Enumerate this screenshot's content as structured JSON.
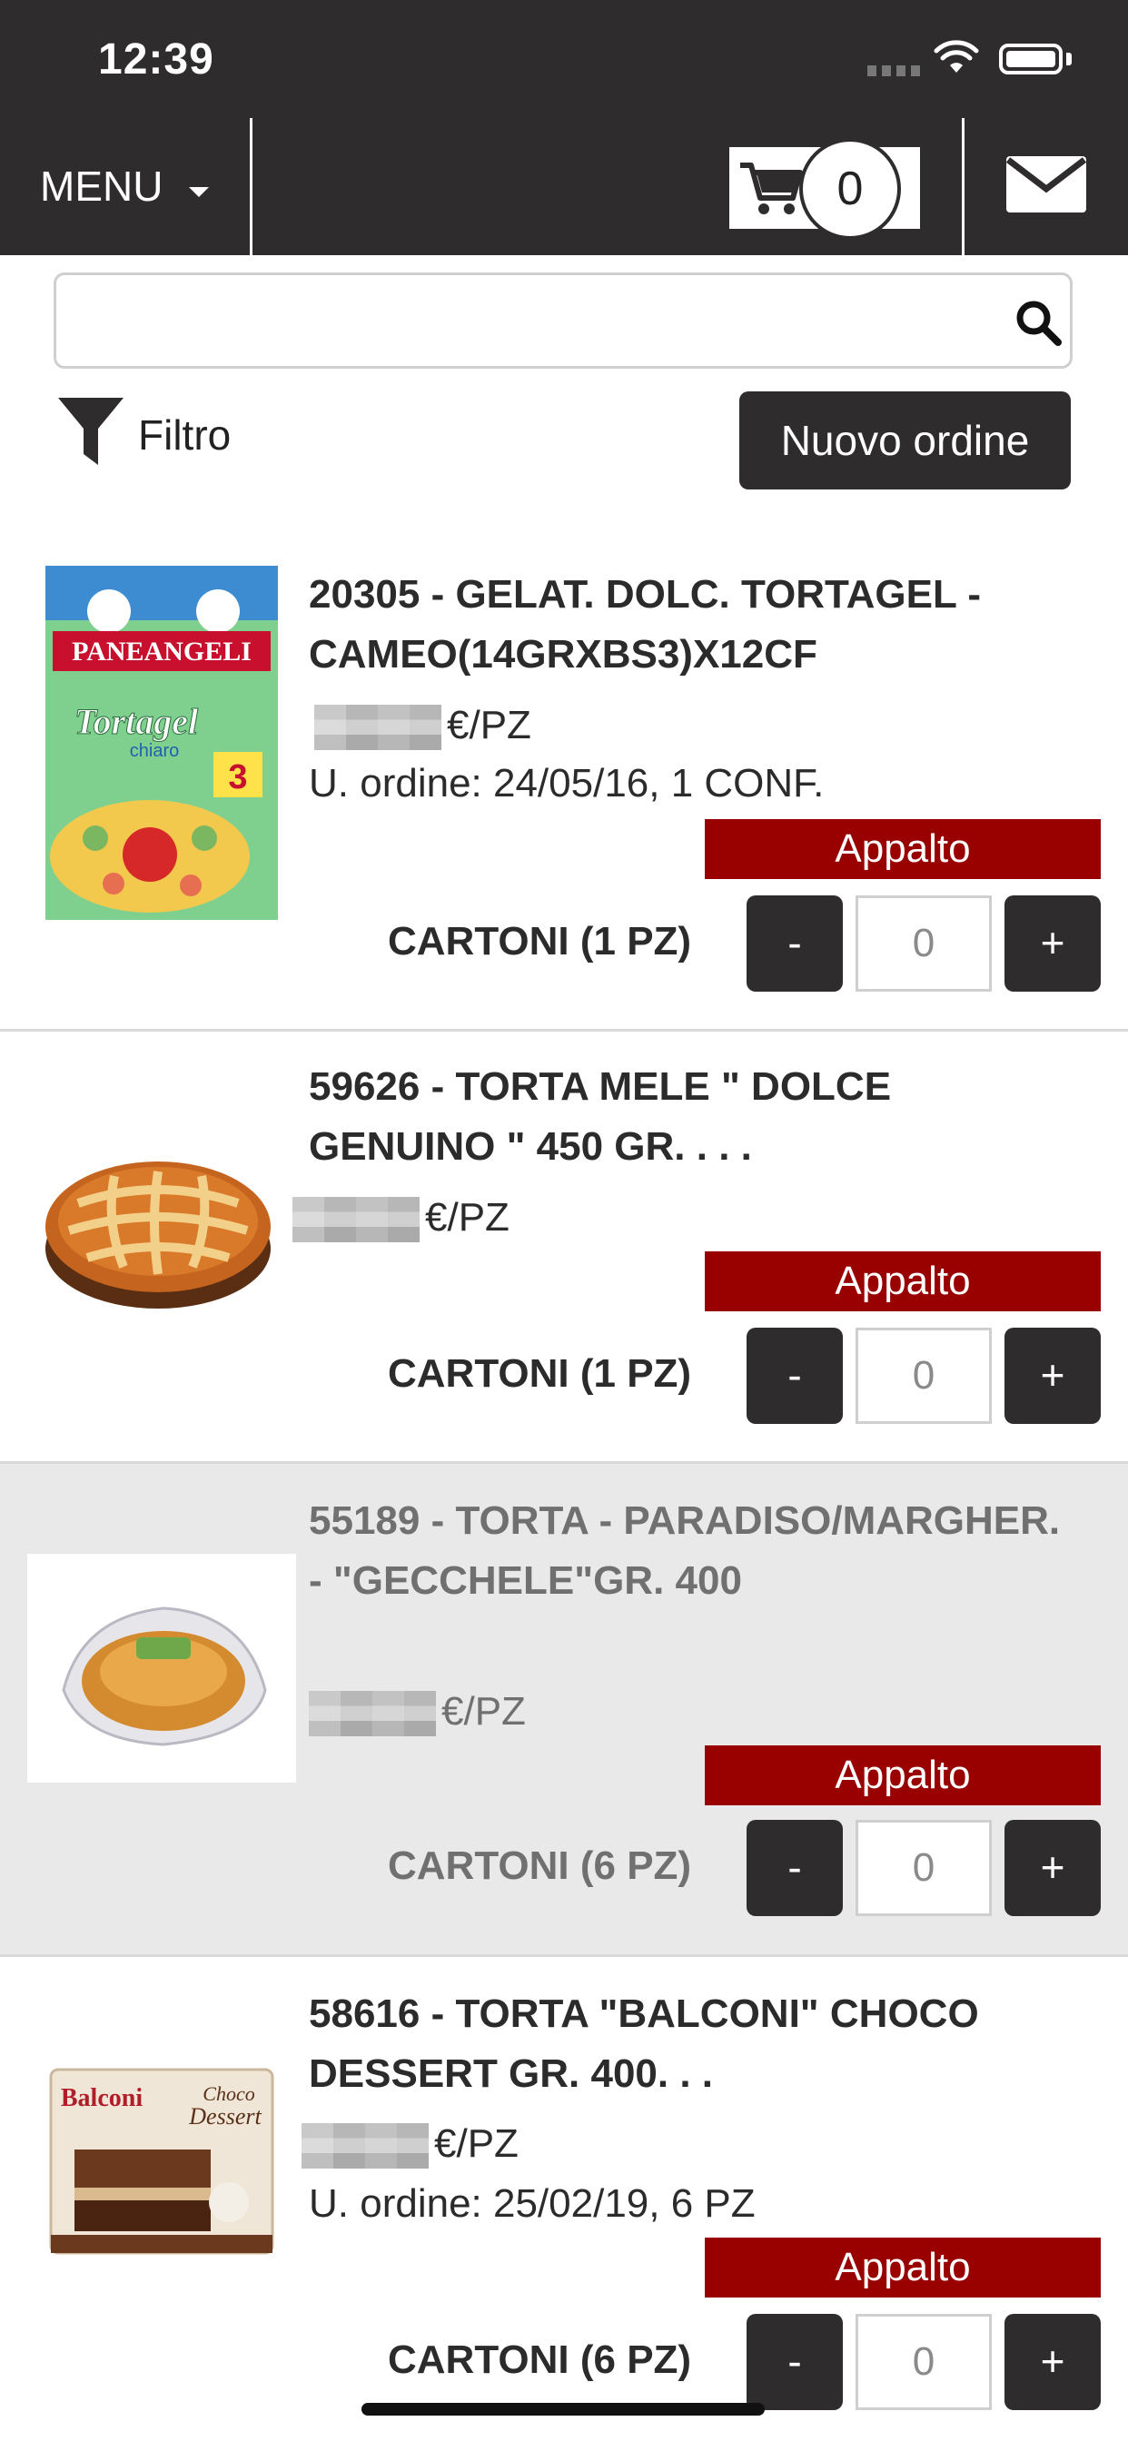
{
  "status_bar": {
    "time": "12:39"
  },
  "header": {
    "menu_label": "MENU",
    "cart_count": "0"
  },
  "search": {
    "placeholder": "",
    "value": ""
  },
  "filter_label": "Filtro",
  "new_order_label": "Nuovo ordine",
  "products": [
    {
      "title": "20305 - GELAT. DOLC. TORTAGEL - CAMEO(14GRXBS3)X12CF",
      "price_unit": "€/PZ",
      "last_order": "U. ordine: 24/05/16, 1 CONF.",
      "badge": "Appalto",
      "pack": "CARTONI (1 PZ)",
      "minus": "-",
      "qty": "0",
      "plus": "+",
      "image_text": [
        "PANEANGELI",
        "Tortagel",
        "chiaro",
        "3"
      ],
      "disabled": false
    },
    {
      "title": "59626 - TORTA MELE \" DOLCE GENUINO \" 450 GR. . . .",
      "price_unit": "€/PZ",
      "badge": "Appalto",
      "pack": "CARTONI (1 PZ)",
      "minus": "-",
      "qty": "0",
      "plus": "+",
      "disabled": false
    },
    {
      "title": "55189 - TORTA - PARADISO/MARGHER. - \"GECCHELE\"GR. 400",
      "price_unit": "€/PZ",
      "badge": "Appalto",
      "pack": "CARTONI (6 PZ)",
      "minus": "-",
      "qty": "0",
      "plus": "+",
      "disabled": true
    },
    {
      "title": "58616 - TORTA \"BALCONI\" CHOCO DESSERT GR. 400. . .",
      "price_unit": "€/PZ",
      "last_order": "U. ordine: 25/02/19, 6 PZ",
      "badge": "Appalto",
      "pack": "CARTONI (6 PZ)",
      "minus": "-",
      "qty": "0",
      "plus": "+",
      "image_text": [
        "Balconi",
        "Choco",
        "Dessert"
      ],
      "disabled": false
    }
  ],
  "colors": {
    "header_bg": "#2e2c2c",
    "badge_bg": "#990000",
    "disabled_bg": "#e9e9e9"
  }
}
